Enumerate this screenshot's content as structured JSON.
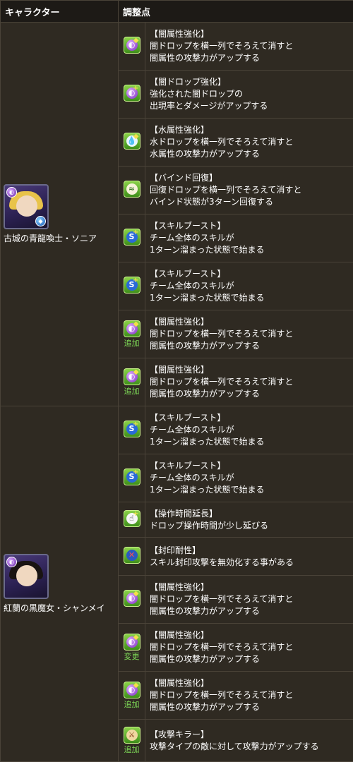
{
  "header": {
    "character": "キャラクター",
    "adjustment": "調整点"
  },
  "characters": [
    {
      "name": "古城の青龍喚士・ソニア",
      "attr_icon": "dark-orb",
      "sub_icon": "water-orb"
    },
    {
      "name": "紅蘭の黒魔女・シャンメイ",
      "attr_icon": "dark-orb",
      "sub_icon": ""
    }
  ],
  "rows": [
    {
      "icon": "dark-orb-enhance-icon",
      "tag": "",
      "title": "【闇属性強化】",
      "line1": "闇ドロップを横一列でそろえて消すと",
      "line2": "闇属性の攻撃力がアップする"
    },
    {
      "icon": "dark-drop-enhance-icon",
      "tag": "",
      "title": "【闇ドロップ強化】",
      "line1": "強化された闇ドロップの",
      "line2": "出現率とダメージがアップする"
    },
    {
      "icon": "water-orb-enhance-icon",
      "tag": "",
      "title": "【水属性強化】",
      "line1": "水ドロップを横一列でそろえて消すと",
      "line2": "水属性の攻撃力がアップする"
    },
    {
      "icon": "bind-recovery-icon",
      "tag": "",
      "title": "【バインド回復】",
      "line1": "回復ドロップを横一列でそろえて消すと",
      "line2": "バインド状態が3ターン回復する"
    },
    {
      "icon": "skill-boost-icon",
      "tag": "",
      "title": "【スキルブースト】",
      "line1": "チーム全体のスキルが",
      "line2": "1ターン溜まった状態で始まる"
    },
    {
      "icon": "skill-boost-icon",
      "tag": "",
      "title": "【スキルブースト】",
      "line1": "チーム全体のスキルが",
      "line2": "1ターン溜まった状態で始まる"
    },
    {
      "icon": "dark-orb-enhance-icon",
      "tag": "追加",
      "title": "【闇属性強化】",
      "line1": "闇ドロップを横一列でそろえて消すと",
      "line2": "闇属性の攻撃力がアップする"
    },
    {
      "icon": "dark-orb-enhance-icon",
      "tag": "追加",
      "title": "【闇属性強化】",
      "line1": "闇ドロップを横一列でそろえて消すと",
      "line2": "闇属性の攻撃力がアップする"
    },
    {
      "icon": "skill-boost-icon",
      "tag": "",
      "title": "【スキルブースト】",
      "line1": "チーム全体のスキルが",
      "line2": "1ターン溜まった状態で始まる"
    },
    {
      "icon": "skill-boost-icon",
      "tag": "",
      "title": "【スキルブースト】",
      "line1": "チーム全体のスキルが",
      "line2": "1ターン溜まった状態で始まる"
    },
    {
      "icon": "time-extend-icon",
      "tag": "",
      "title": "【操作時間延長】",
      "line1": "ドロップ操作時間が少し延びる",
      "line2": ""
    },
    {
      "icon": "seal-resist-icon",
      "tag": "",
      "title": "【封印耐性】",
      "line1": "スキル封印攻撃を無効化する事がある",
      "line2": ""
    },
    {
      "icon": "dark-orb-enhance-icon",
      "tag": "",
      "title": "【闇属性強化】",
      "line1": "闇ドロップを横一列でそろえて消すと",
      "line2": "闇属性の攻撃力がアップする"
    },
    {
      "icon": "dark-orb-enhance-icon",
      "tag": "変更",
      "title": "【闇属性強化】",
      "line1": "闇ドロップを横一列でそろえて消すと",
      "line2": "闇属性の攻撃力がアップする"
    },
    {
      "icon": "dark-orb-enhance-icon",
      "tag": "追加",
      "title": "【闇属性強化】",
      "line1": "闇ドロップを横一列でそろえて消すと",
      "line2": "闇属性の攻撃力がアップする"
    },
    {
      "icon": "attacker-killer-icon",
      "tag": "追加",
      "title": "【攻撃キラー】",
      "line1": "攻撃タイプの敵に対して攻撃力がアップする",
      "line2": ""
    }
  ]
}
